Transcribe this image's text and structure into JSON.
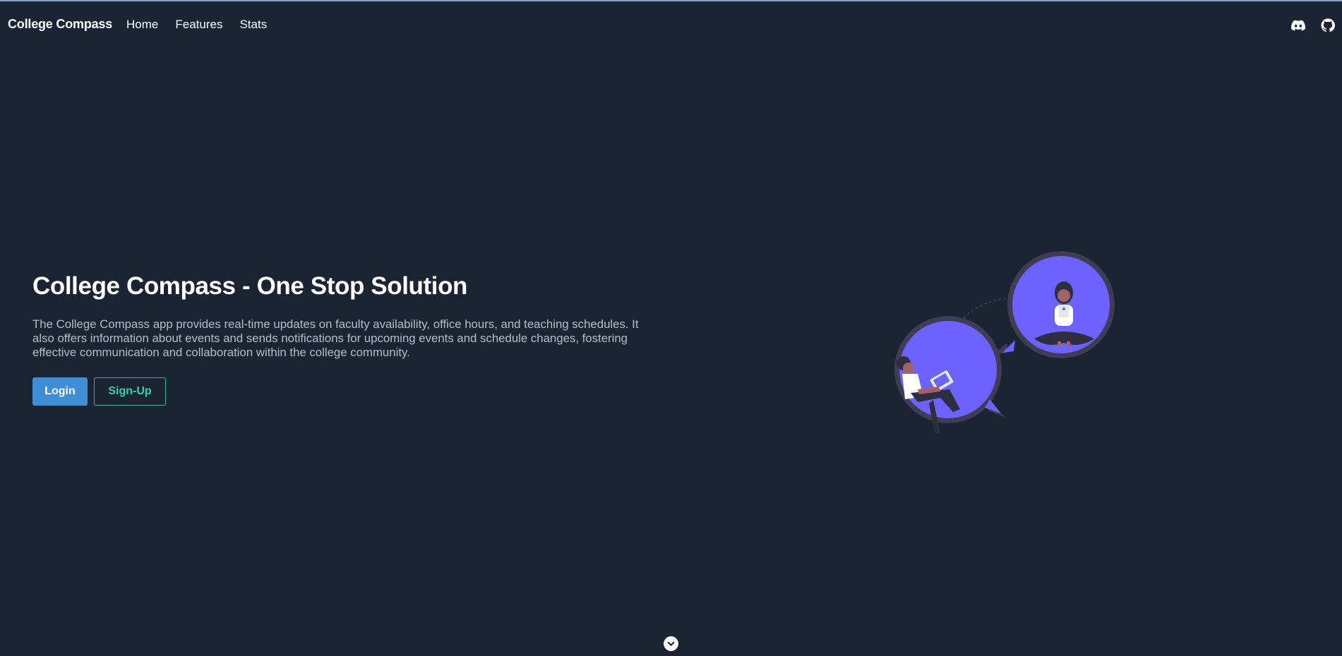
{
  "navbar": {
    "brand": "College Compass",
    "links": [
      {
        "label": "Home"
      },
      {
        "label": "Features"
      },
      {
        "label": "Stats"
      }
    ],
    "icons": [
      "discord-icon",
      "github-icon"
    ]
  },
  "hero": {
    "title": "College Compass - One Stop Solution",
    "description": "The College Compass app provides real-time updates on faculty availability, office hours, and teaching schedules. It also offers information about events and sends notifications for upcoming events and schedule changes, fostering effective communication and collaboration within the college community.",
    "login_label": "Login",
    "signup_label": "Sign-Up"
  },
  "colors": {
    "background": "#1b2433",
    "primary_button": "#3f8fd6",
    "accent_teal": "#2fd1b5",
    "illustration_purple": "#6c63ff"
  },
  "scroll_icon": "chevron-down-icon"
}
